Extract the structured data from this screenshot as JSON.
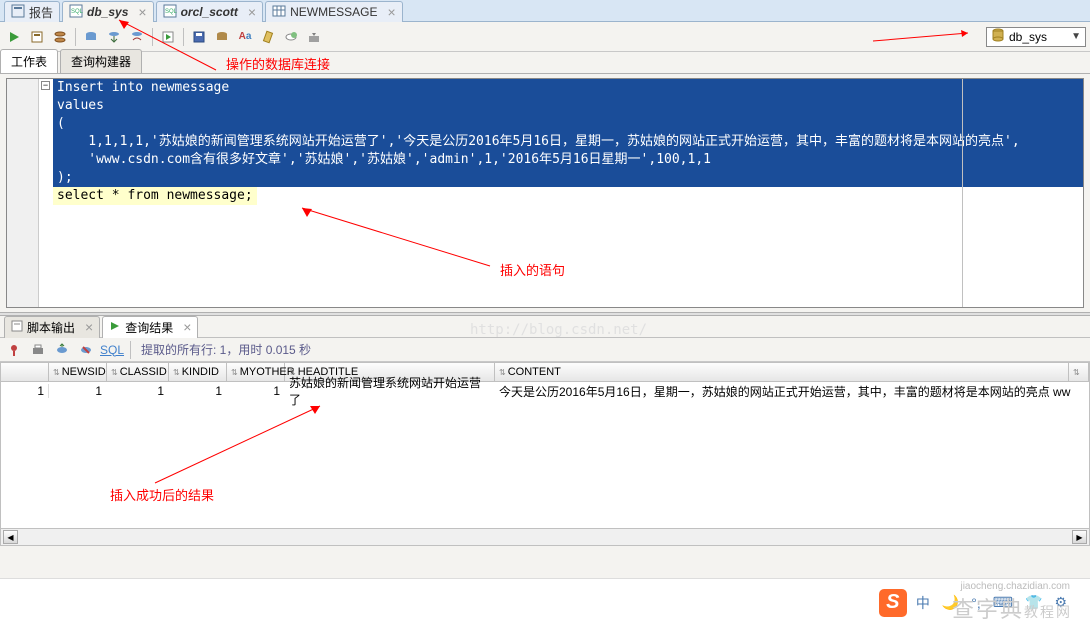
{
  "doc_tabs": [
    {
      "label": "报告",
      "icon": "report",
      "closable": false
    },
    {
      "label": "db_sys",
      "icon": "sql",
      "closable": true,
      "active": true
    },
    {
      "label": "orcl_scott",
      "icon": "sql",
      "closable": true
    },
    {
      "label": "NEWMESSAGE",
      "icon": "table",
      "closable": true
    }
  ],
  "connection": {
    "label": "db_sys"
  },
  "worksheet_tabs": {
    "ws": "工作表",
    "qb": "查询构建器"
  },
  "sql": {
    "line1": "Insert into newmessage",
    "line2": "values",
    "line3": "(",
    "line4": "    1,1,1,1,'苏姑娘的新闻管理系统网站开始运营了','今天是公历2016年5月16日，星期一，苏姑娘的网站正式开始运营，其中，丰富的题材将是本网站的亮点',",
    "line5": "    'www.csdn.com含有很多好文章','苏姑娘','苏姑娘','admin',1,'2016年5月16日星期一',100,1,1",
    "line6": ");",
    "line7": "select * from newmessage;"
  },
  "annotations": {
    "a1": "操作的数据库连接",
    "a2": "插入的语句",
    "a3": "插入成功后的结果"
  },
  "output_tabs": {
    "script": "脚本输出",
    "result": "查询结果"
  },
  "result_toolbar": {
    "sql_link": "SQL",
    "status": "提取的所有行: 1，用时 0.015 秒"
  },
  "grid": {
    "headers": [
      "",
      "NEWSID",
      "CLASSID",
      "KINDID",
      "MYOTHER",
      "HEADTITLE",
      "CONTENT"
    ],
    "row_num": "1",
    "cells": {
      "newsid": "1",
      "classid": "1",
      "kindid": "1",
      "myother": "1",
      "headtitle": "苏姑娘的新闻管理系统网站开始运营了",
      "content": "今天是公历2016年5月16日，星期一，苏姑娘的网站正式开始运营，其中，丰富的题材将是本网站的亮点 ww"
    }
  },
  "watermark": "http://blog.csdn.net/",
  "brand": {
    "main": "查字典",
    "sub": "教程网",
    "url": "jiaocheng.chazidian.com"
  },
  "ime_icons": [
    "中",
    "🌙",
    "°,",
    "⌨",
    "👕",
    "⚙"
  ]
}
